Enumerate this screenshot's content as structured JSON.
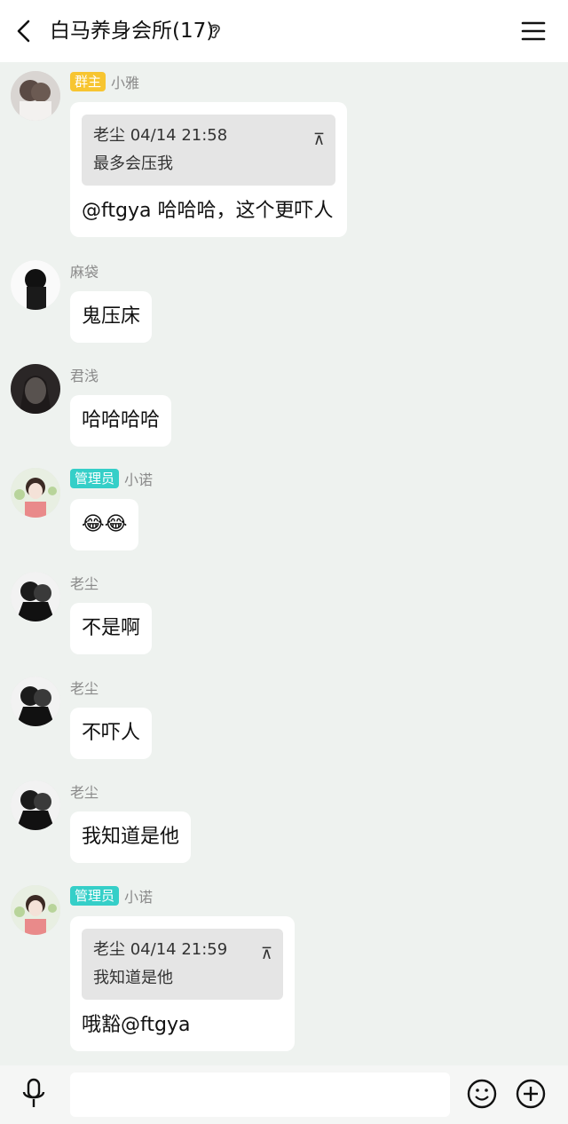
{
  "header": {
    "title": "白马养身会所(17)"
  },
  "messages": [
    {
      "badge": "群主",
      "sender": "小雅",
      "quote": {
        "meta": "老尘 04/14 21:58",
        "text": "最多会压我"
      },
      "text": "@ftgya 哈哈哈，这个更吓人"
    },
    {
      "badge": "",
      "sender": "麻袋",
      "text": "鬼压床"
    },
    {
      "badge": "",
      "sender": "君浅",
      "text": "哈哈哈哈"
    },
    {
      "badge": "管理员",
      "sender": "小诺",
      "text": "😂😂"
    },
    {
      "badge": "",
      "sender": "老尘",
      "text": "不是啊"
    },
    {
      "badge": "",
      "sender": "老尘",
      "text": "不吓人"
    },
    {
      "badge": "",
      "sender": "老尘",
      "text": "我知道是他"
    },
    {
      "badge": "管理员",
      "sender": "小诺",
      "quote": {
        "meta": "老尘 04/14 21:59",
        "text": "我知道是他"
      },
      "text": "哦豁@ftgya"
    }
  ],
  "colors": {
    "owner_badge": "#f7c531",
    "admin_badge": "#35cfc8",
    "background": "#eef2ef"
  }
}
